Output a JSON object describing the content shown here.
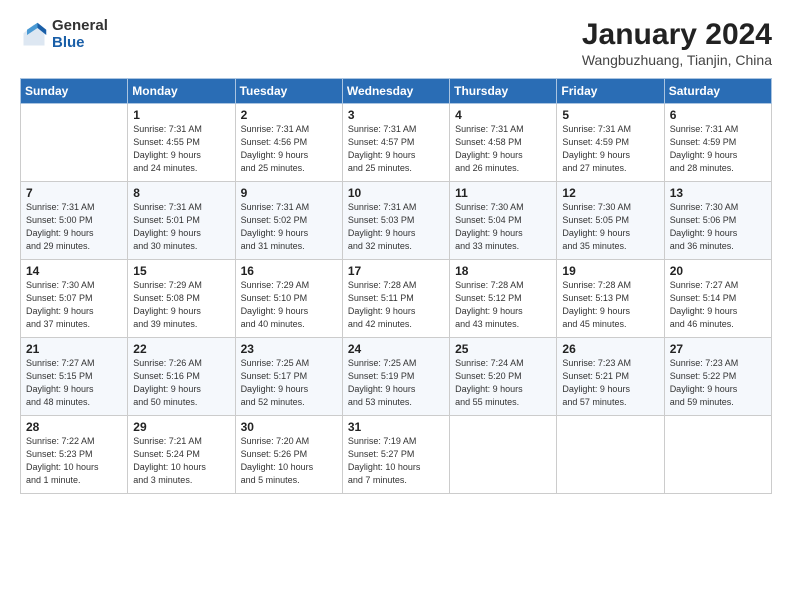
{
  "logo": {
    "general": "General",
    "blue": "Blue"
  },
  "title": "January 2024",
  "subtitle": "Wangbuzhuang, Tianjin, China",
  "headers": [
    "Sunday",
    "Monday",
    "Tuesday",
    "Wednesday",
    "Thursday",
    "Friday",
    "Saturday"
  ],
  "weeks": [
    [
      {
        "day": "",
        "info": ""
      },
      {
        "day": "1",
        "info": "Sunrise: 7:31 AM\nSunset: 4:55 PM\nDaylight: 9 hours\nand 24 minutes."
      },
      {
        "day": "2",
        "info": "Sunrise: 7:31 AM\nSunset: 4:56 PM\nDaylight: 9 hours\nand 25 minutes."
      },
      {
        "day": "3",
        "info": "Sunrise: 7:31 AM\nSunset: 4:57 PM\nDaylight: 9 hours\nand 25 minutes."
      },
      {
        "day": "4",
        "info": "Sunrise: 7:31 AM\nSunset: 4:58 PM\nDaylight: 9 hours\nand 26 minutes."
      },
      {
        "day": "5",
        "info": "Sunrise: 7:31 AM\nSunset: 4:59 PM\nDaylight: 9 hours\nand 27 minutes."
      },
      {
        "day": "6",
        "info": "Sunrise: 7:31 AM\nSunset: 4:59 PM\nDaylight: 9 hours\nand 28 minutes."
      }
    ],
    [
      {
        "day": "7",
        "info": "Sunrise: 7:31 AM\nSunset: 5:00 PM\nDaylight: 9 hours\nand 29 minutes."
      },
      {
        "day": "8",
        "info": "Sunrise: 7:31 AM\nSunset: 5:01 PM\nDaylight: 9 hours\nand 30 minutes."
      },
      {
        "day": "9",
        "info": "Sunrise: 7:31 AM\nSunset: 5:02 PM\nDaylight: 9 hours\nand 31 minutes."
      },
      {
        "day": "10",
        "info": "Sunrise: 7:31 AM\nSunset: 5:03 PM\nDaylight: 9 hours\nand 32 minutes."
      },
      {
        "day": "11",
        "info": "Sunrise: 7:30 AM\nSunset: 5:04 PM\nDaylight: 9 hours\nand 33 minutes."
      },
      {
        "day": "12",
        "info": "Sunrise: 7:30 AM\nSunset: 5:05 PM\nDaylight: 9 hours\nand 35 minutes."
      },
      {
        "day": "13",
        "info": "Sunrise: 7:30 AM\nSunset: 5:06 PM\nDaylight: 9 hours\nand 36 minutes."
      }
    ],
    [
      {
        "day": "14",
        "info": "Sunrise: 7:30 AM\nSunset: 5:07 PM\nDaylight: 9 hours\nand 37 minutes."
      },
      {
        "day": "15",
        "info": "Sunrise: 7:29 AM\nSunset: 5:08 PM\nDaylight: 9 hours\nand 39 minutes."
      },
      {
        "day": "16",
        "info": "Sunrise: 7:29 AM\nSunset: 5:10 PM\nDaylight: 9 hours\nand 40 minutes."
      },
      {
        "day": "17",
        "info": "Sunrise: 7:28 AM\nSunset: 5:11 PM\nDaylight: 9 hours\nand 42 minutes."
      },
      {
        "day": "18",
        "info": "Sunrise: 7:28 AM\nSunset: 5:12 PM\nDaylight: 9 hours\nand 43 minutes."
      },
      {
        "day": "19",
        "info": "Sunrise: 7:28 AM\nSunset: 5:13 PM\nDaylight: 9 hours\nand 45 minutes."
      },
      {
        "day": "20",
        "info": "Sunrise: 7:27 AM\nSunset: 5:14 PM\nDaylight: 9 hours\nand 46 minutes."
      }
    ],
    [
      {
        "day": "21",
        "info": "Sunrise: 7:27 AM\nSunset: 5:15 PM\nDaylight: 9 hours\nand 48 minutes."
      },
      {
        "day": "22",
        "info": "Sunrise: 7:26 AM\nSunset: 5:16 PM\nDaylight: 9 hours\nand 50 minutes."
      },
      {
        "day": "23",
        "info": "Sunrise: 7:25 AM\nSunset: 5:17 PM\nDaylight: 9 hours\nand 52 minutes."
      },
      {
        "day": "24",
        "info": "Sunrise: 7:25 AM\nSunset: 5:19 PM\nDaylight: 9 hours\nand 53 minutes."
      },
      {
        "day": "25",
        "info": "Sunrise: 7:24 AM\nSunset: 5:20 PM\nDaylight: 9 hours\nand 55 minutes."
      },
      {
        "day": "26",
        "info": "Sunrise: 7:23 AM\nSunset: 5:21 PM\nDaylight: 9 hours\nand 57 minutes."
      },
      {
        "day": "27",
        "info": "Sunrise: 7:23 AM\nSunset: 5:22 PM\nDaylight: 9 hours\nand 59 minutes."
      }
    ],
    [
      {
        "day": "28",
        "info": "Sunrise: 7:22 AM\nSunset: 5:23 PM\nDaylight: 10 hours\nand 1 minute."
      },
      {
        "day": "29",
        "info": "Sunrise: 7:21 AM\nSunset: 5:24 PM\nDaylight: 10 hours\nand 3 minutes."
      },
      {
        "day": "30",
        "info": "Sunrise: 7:20 AM\nSunset: 5:26 PM\nDaylight: 10 hours\nand 5 minutes."
      },
      {
        "day": "31",
        "info": "Sunrise: 7:19 AM\nSunset: 5:27 PM\nDaylight: 10 hours\nand 7 minutes."
      },
      {
        "day": "",
        "info": ""
      },
      {
        "day": "",
        "info": ""
      },
      {
        "day": "",
        "info": ""
      }
    ]
  ]
}
